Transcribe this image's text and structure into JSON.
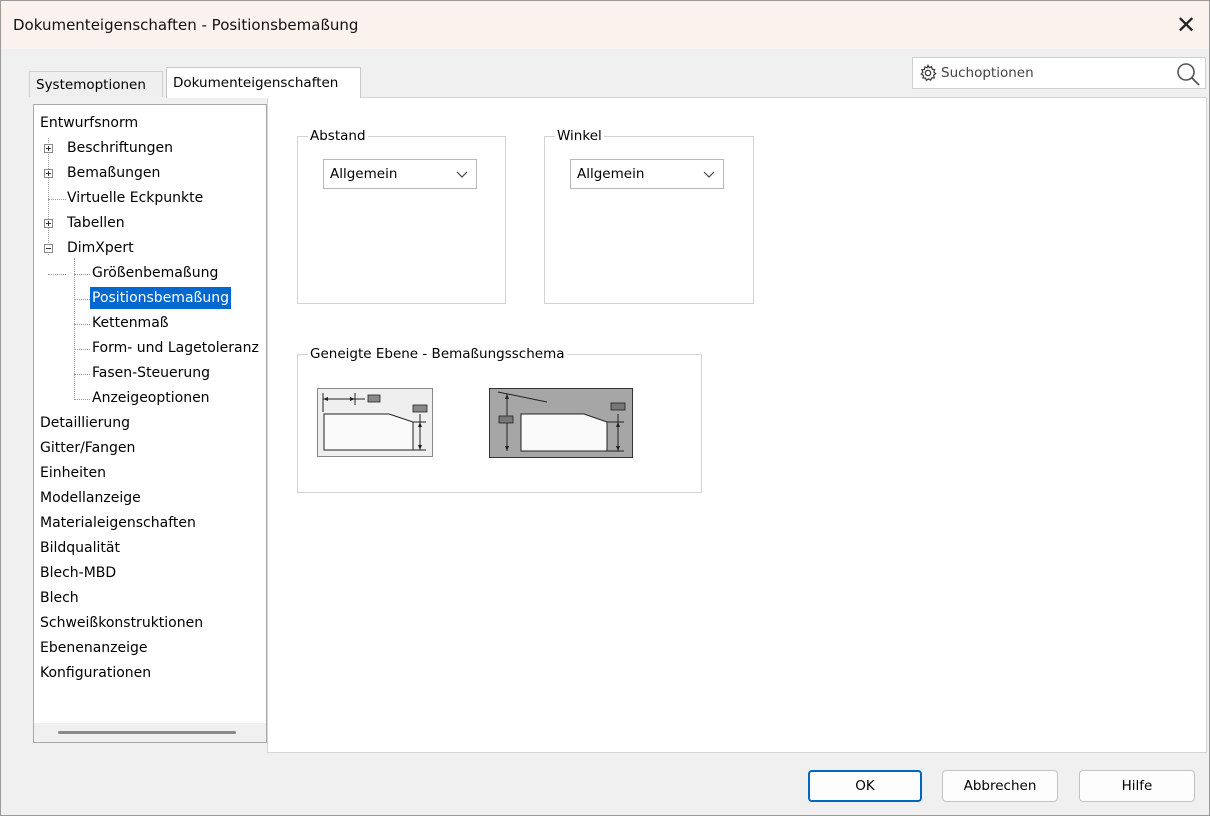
{
  "window": {
    "title": "Dokumenteigenschaften - Positionsbemaßung",
    "close_glyph": "✕"
  },
  "tabs": [
    {
      "label": "Systemoptionen",
      "active": false
    },
    {
      "label": "Dokumenteigenschaften",
      "active": true
    }
  ],
  "search": {
    "placeholder": "Suchoptionen",
    "icon": "gear-icon",
    "button_icon": "magnifier-icon"
  },
  "tree": {
    "items": [
      {
        "label": "Entwurfsnorm",
        "level": 0
      },
      {
        "label": "Beschriftungen",
        "level": 1,
        "expander": "plus"
      },
      {
        "label": "Bemaßungen",
        "level": 1,
        "expander": "plus"
      },
      {
        "label": "Virtuelle Eckpunkte",
        "level": 1
      },
      {
        "label": "Tabellen",
        "level": 1,
        "expander": "plus"
      },
      {
        "label": "DimXpert",
        "level": 1,
        "expander": "minus"
      },
      {
        "label": "Größenbemaßung",
        "level": 2
      },
      {
        "label": "Positionsbemaßung",
        "level": 2,
        "selected": true
      },
      {
        "label": "Kettenmaß",
        "level": 2
      },
      {
        "label": "Form- und Lagetoleranz",
        "level": 2
      },
      {
        "label": "Fasen-Steuerung",
        "level": 2
      },
      {
        "label": "Anzeigeoptionen",
        "level": 2
      },
      {
        "label": "Detaillierung",
        "level": 0
      },
      {
        "label": "Gitter/Fangen",
        "level": 0
      },
      {
        "label": "Einheiten",
        "level": 0
      },
      {
        "label": "Modellanzeige",
        "level": 0
      },
      {
        "label": "Materialeigenschaften",
        "level": 0
      },
      {
        "label": "Bildqualität",
        "level": 0
      },
      {
        "label": "Blech-MBD",
        "level": 0
      },
      {
        "label": "Blech",
        "level": 0
      },
      {
        "label": "Schweißkonstruktionen",
        "level": 0
      },
      {
        "label": "Ebenenanzeige",
        "level": 0
      },
      {
        "label": "Konfigurationen",
        "level": 0
      }
    ]
  },
  "abstand": {
    "legend": "Abstand",
    "value": "Allgemein"
  },
  "winkel": {
    "legend": "Winkel",
    "value": "Allgemein"
  },
  "scheme": {
    "legend": "Geneigte Ebene - Bemaßungsschema",
    "selected_option": 2
  },
  "buttons": {
    "ok": "OK",
    "cancel": "Abbrechen",
    "help": "Hilfe"
  },
  "colors": {
    "selection": "#0068cf",
    "titlebar": "#fbf2ee",
    "default_button_border": "#0067c0"
  }
}
